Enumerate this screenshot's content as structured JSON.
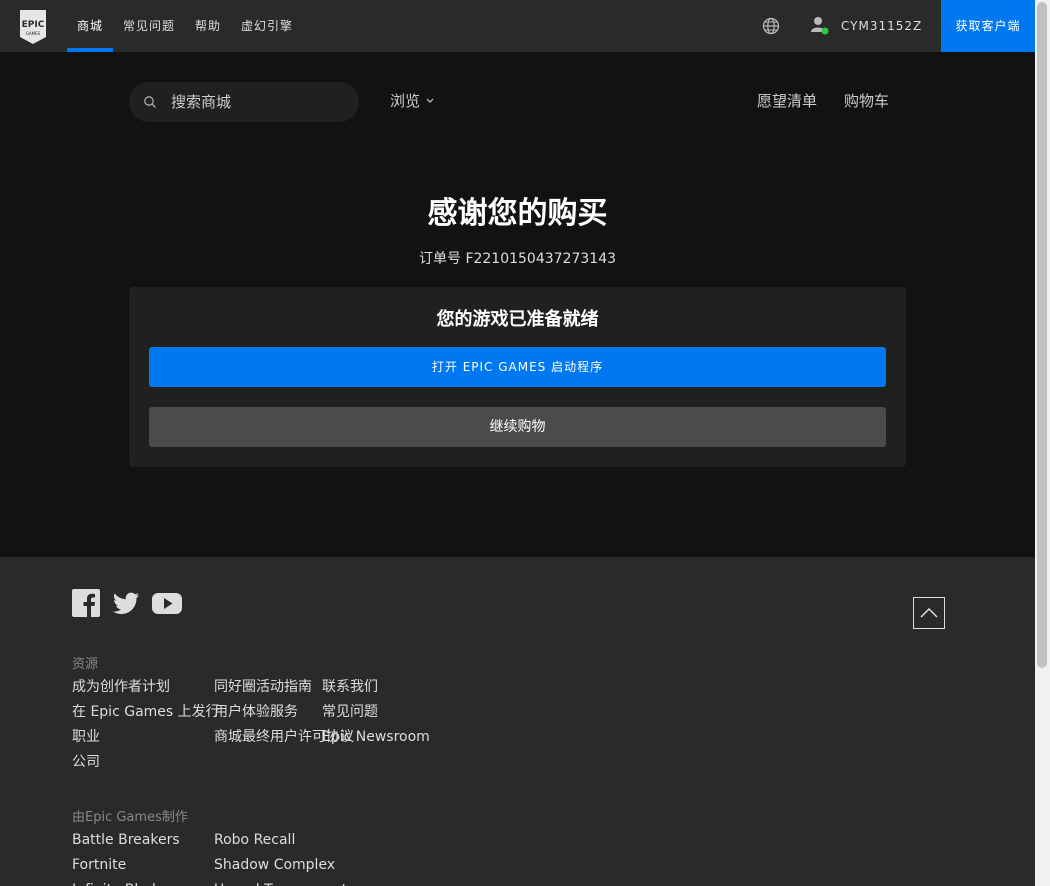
{
  "header": {
    "logo_text": "EPIC GAMES",
    "nav": [
      "商城",
      "常见问题",
      "帮助",
      "虚幻引擎"
    ],
    "username": "CYM31152Z",
    "download_label": "获取客户端"
  },
  "search": {
    "placeholder": "搜索商城"
  },
  "subnav": {
    "browse": "浏览",
    "wishlist": "愿望清单",
    "cart": "购物车"
  },
  "main": {
    "title": "感谢您的购买",
    "order_label": "订单号",
    "order_number": "F2210150437273143",
    "card_heading": "您的游戏已准备就绪",
    "primary_button": "打开 EPIC GAMES 启动程序",
    "secondary_button": "继续购物"
  },
  "footer": {
    "resources_title": "资源",
    "col1": [
      "成为创作者计划",
      "在 Epic Games 上发行",
      "职业",
      "公司"
    ],
    "col2": [
      "同好圈活动指南",
      "用户体验服务",
      "商城最终用户许可协议"
    ],
    "col3": [
      "联系我们",
      "常见问题",
      "Epic Newsroom"
    ],
    "games_title": "由Epic Games制作",
    "games_col1": [
      "Battle Breakers",
      "Fortnite",
      "Infinity Blade"
    ],
    "games_col2": [
      "Robo Recall",
      "Shadow Complex",
      "Unreal Tournament"
    ]
  },
  "colors": {
    "accent": "#0078f2",
    "background": "#121212",
    "panel": "#202020",
    "online": "#2ecc40"
  },
  "icons": [
    "epic-logo-icon",
    "globe-icon",
    "user-icon",
    "search-icon",
    "chevron-down-icon",
    "facebook-icon",
    "twitter-icon",
    "youtube-icon",
    "chevron-up-icon"
  ]
}
